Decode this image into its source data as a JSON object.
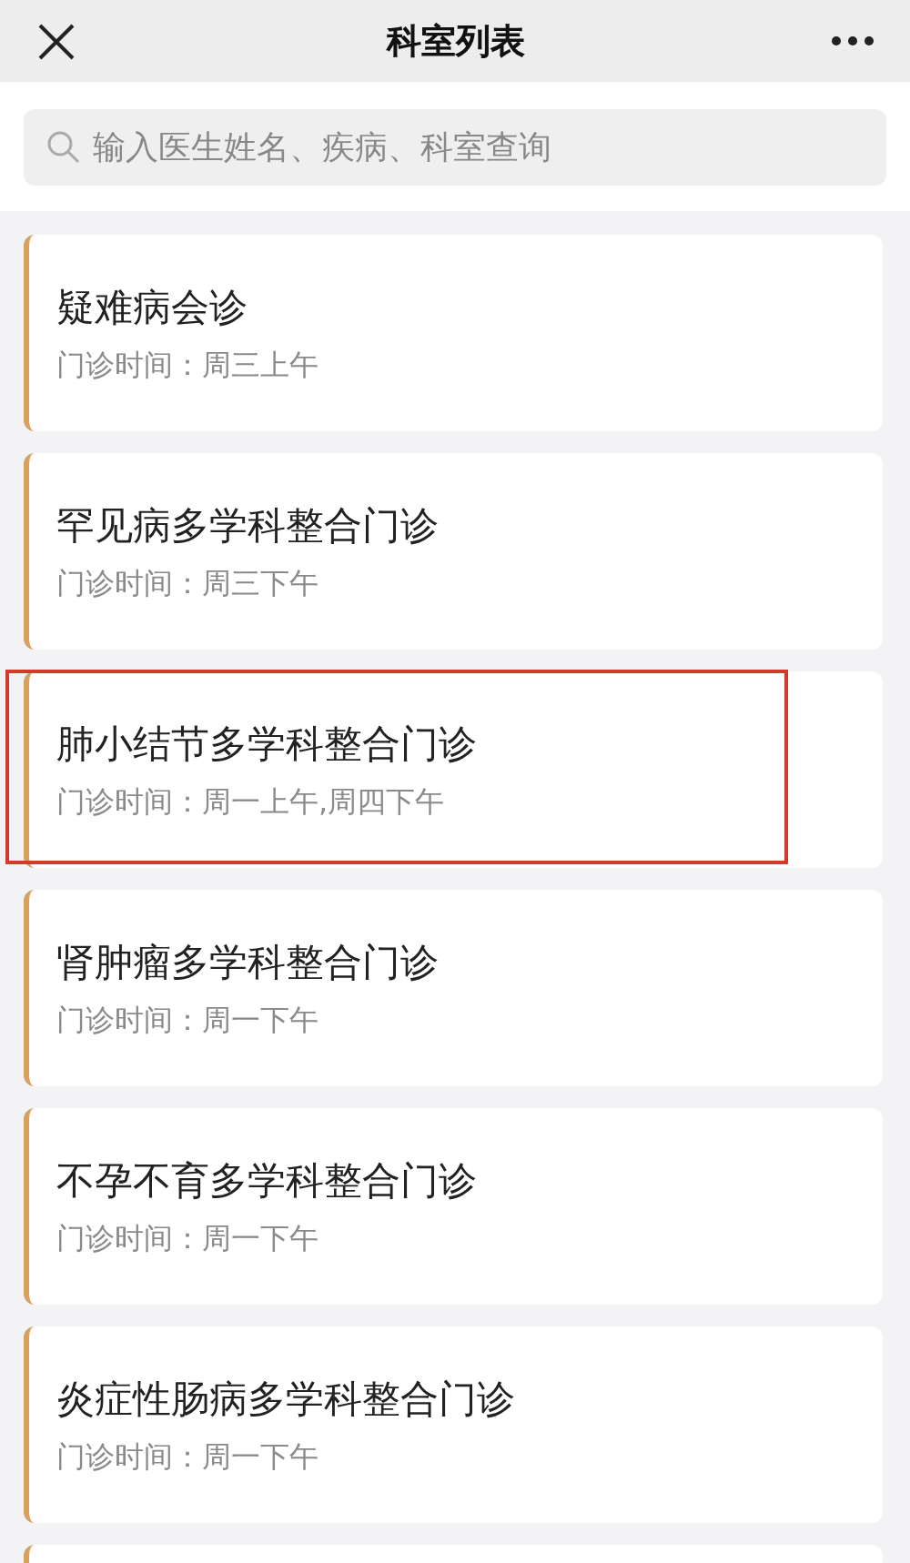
{
  "header": {
    "title": "科室列表"
  },
  "search": {
    "placeholder": "输入医生姓名、疾病、科室查询"
  },
  "departments": [
    {
      "name": "疑难病会诊",
      "schedule": "门诊时间：周三上午",
      "highlighted": false
    },
    {
      "name": "罕见病多学科整合门诊",
      "schedule": "门诊时间：周三下午",
      "highlighted": false
    },
    {
      "name": "肺小结节多学科整合门诊",
      "schedule": "门诊时间：周一上午,周四下午",
      "highlighted": true
    },
    {
      "name": "肾肿瘤多学科整合门诊",
      "schedule": "门诊时间：周一下午",
      "highlighted": false
    },
    {
      "name": "不孕不育多学科整合门诊",
      "schedule": "门诊时间：周一下午",
      "highlighted": false
    },
    {
      "name": "炎症性肠病多学科整合门诊",
      "schedule": "门诊时间：周一下午",
      "highlighted": false
    }
  ]
}
